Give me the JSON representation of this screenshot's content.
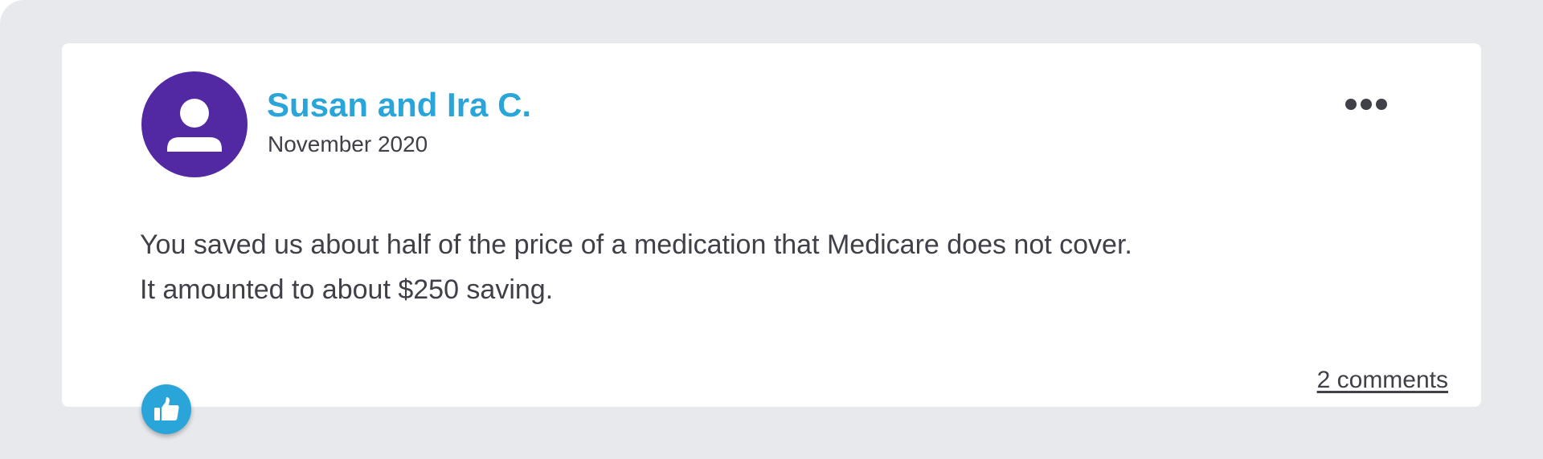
{
  "review": {
    "author": "Susan and Ira C.",
    "date": "November 2020",
    "text_lines": [
      "You saved us about half of the price of a medication that Medicare does not cover.",
      "It amounted to about $250 saving."
    ],
    "comments_link": "2 comments"
  },
  "icons": {
    "avatar": "user-silhouette-icon",
    "more": "more-horizontal-icon",
    "like": "thumbs-up-icon"
  },
  "colors": {
    "background": "#e8e9ec",
    "card": "#ffffff",
    "avatar": "#5229a3",
    "accent": "#2aa5d9",
    "text": "#3f4048"
  }
}
